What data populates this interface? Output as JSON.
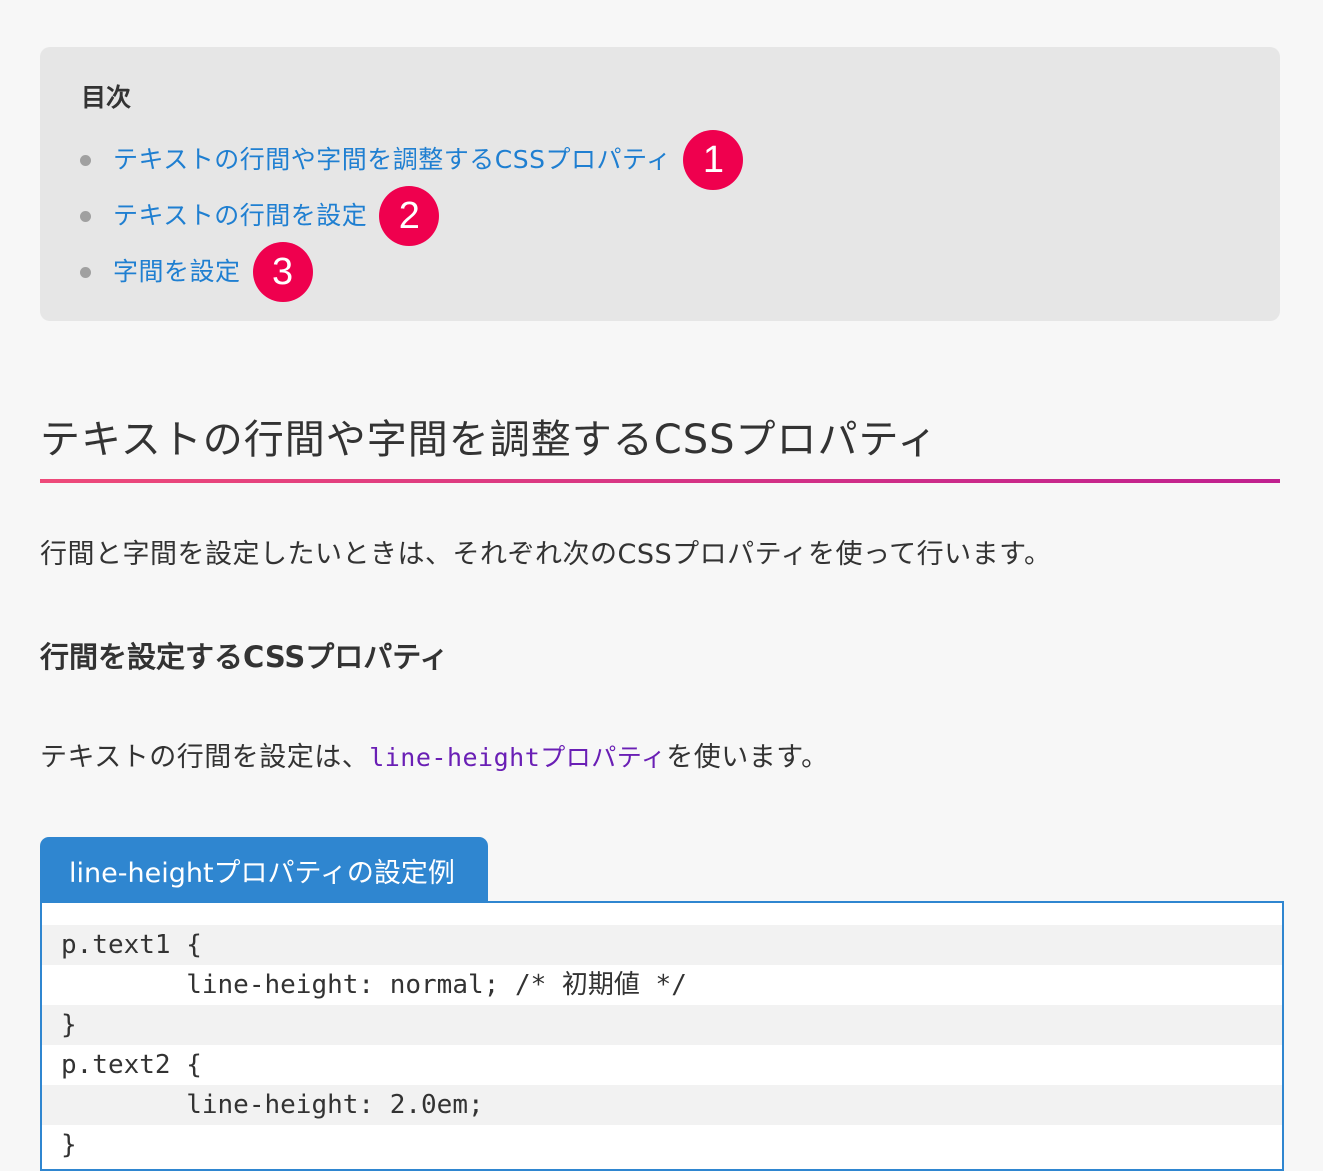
{
  "toc": {
    "title": "目次",
    "items": [
      {
        "label": "テキストの行間や字間を調整するCSSプロパティ",
        "badge": "1"
      },
      {
        "label": "テキストの行間を設定",
        "badge": "2"
      },
      {
        "label": "字間を設定",
        "badge": "3"
      }
    ],
    "badge_color": "#ef004e",
    "link_color": "#1f7fd1"
  },
  "section": {
    "heading": "テキストの行間や字間を調整するCSSプロパティ",
    "intro": "行間と字間を設定したいときは、それぞれ次のCSSプロパティを使って行います。",
    "subheading": "行間を設定するCSSプロパティ",
    "para_before": "テキストの行間を設定は、",
    "para_code": "line-heightプロパティ",
    "para_after": "を使います。"
  },
  "code_example": {
    "tab_label": "line-heightプロパティの設定例",
    "lines": [
      "p.text1 {",
      "        line-height: normal; /* 初期値 */",
      "}",
      "p.text2 {",
      "        line-height: 2.0em;",
      "}"
    ],
    "accent_color": "#2f86d0"
  }
}
